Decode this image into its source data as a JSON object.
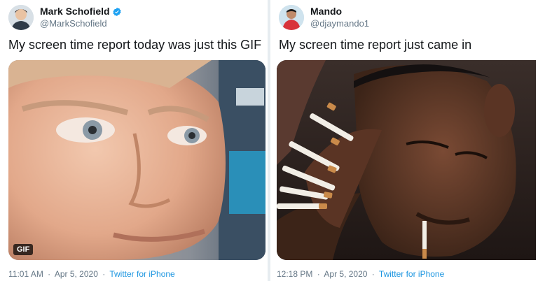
{
  "tweets": [
    {
      "name": "Mark Schofield",
      "handle": "@MarkSchofield",
      "verified": true,
      "text": "My screen time report today was just this GIF",
      "media_badge": "GIF",
      "time": "11:01 AM",
      "date": "Apr 5, 2020",
      "source": "Twitter for iPhone"
    },
    {
      "name": "Mando",
      "handle": "@djaymando1",
      "verified": false,
      "text": "My screen time report just came in",
      "time": "12:18 PM",
      "date": "Apr 5, 2020",
      "source": "Twitter for iPhone"
    }
  ],
  "meta_separator": "·",
  "colors": {
    "link": "#1b95e0",
    "muted": "#657786",
    "text": "#14171a",
    "verified": "#1da1f2"
  },
  "icons": [
    "verified-badge-icon"
  ]
}
